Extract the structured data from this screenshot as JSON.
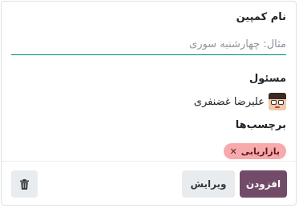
{
  "form": {
    "name_label": "نام کمپین",
    "name_placeholder": "مثال: چهارشنبه سوری",
    "name_value": "",
    "responsible_label": "مسئول",
    "responsible_user": "علیرضا غضنفری",
    "tags_label": "برچسب‌ها",
    "tags": [
      {
        "label": "بازاریابی",
        "color": "#f7a9ab"
      }
    ]
  },
  "actions": {
    "add_label": "افزودن",
    "edit_label": "ویرایش"
  },
  "icons": {
    "avatar": "user-avatar-icon",
    "tag_remove": "close-icon",
    "delete": "trash-icon"
  },
  "colors": {
    "primary": "#714b67",
    "input_underline": "#017e84",
    "secondary_button": "#e9ecef",
    "tag_background": "#f7a9ab"
  }
}
